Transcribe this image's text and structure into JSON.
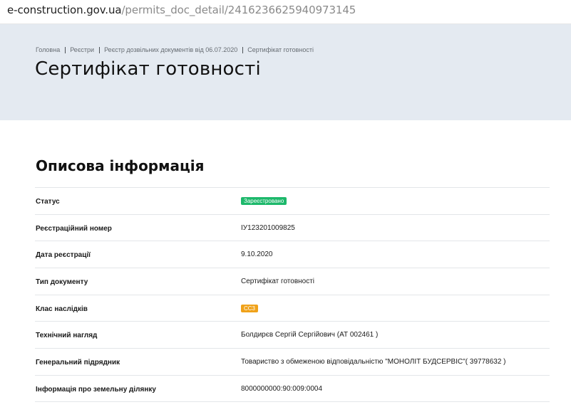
{
  "browser": {
    "url_host": "e-construction.gov.ua",
    "url_path": "/permits_doc_detail/2416236625940973145"
  },
  "breadcrumb": [
    "Головна",
    "Реєстри",
    "Реєстр дозвільних документів від 06.07.2020",
    "Сертифікат готовності"
  ],
  "page_title": "Сертифікат готовності",
  "section_title": "Описова інформація",
  "rows": [
    {
      "label": "Статус",
      "value": "Зареєстровано",
      "badge": "green"
    },
    {
      "label": "Реєстраційний номер",
      "value": "IУ123201009825"
    },
    {
      "label": "Дата реєстрації",
      "value": "9.10.2020"
    },
    {
      "label": "Тип документу",
      "value": "Сертифікат готовності"
    },
    {
      "label": "Клас наслідків",
      "value": "СС3",
      "badge": "orange"
    },
    {
      "label": "Технічний нагляд",
      "value": "Болдирєв Сергій Сергійович (АТ 002461 )"
    },
    {
      "label": "Генеральний підрядник",
      "value": "Товариство з обмеженою відповідальністю \"МОНОЛІТ БУДСЕРВІС\"( 39778632 )"
    },
    {
      "label": "Інформація про земельну ділянку",
      "value": "8000000000:90:009:0004"
    }
  ],
  "colors": {
    "hero_bg": "#e4eaf1",
    "status_badge": "#1db86b",
    "class_badge": "#f0a21a"
  }
}
